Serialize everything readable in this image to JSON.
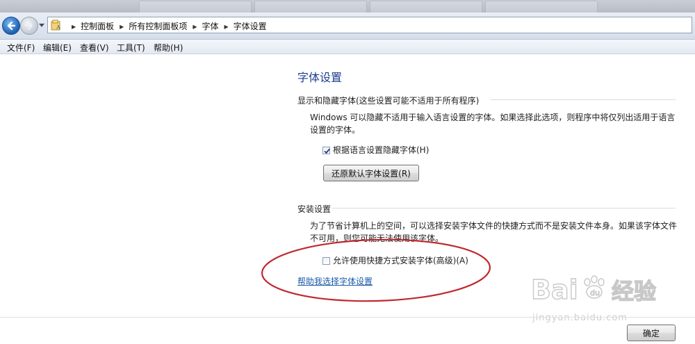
{
  "navigation": {
    "breadcrumbs": [
      "控制面板",
      "所有控制面板项",
      "字体",
      "字体设置"
    ]
  },
  "menu": {
    "items": [
      "文件(F)",
      "编辑(E)",
      "查看(V)",
      "工具(T)",
      "帮助(H)"
    ]
  },
  "page": {
    "title": "字体设置",
    "display_group": {
      "header": "显示和隐藏字体(这些设置可能不适用于所有程序)",
      "description": "Windows 可以隐藏不适用于输入语言设置的字体。如果选择此选项，则程序中将仅列出适用于语言设置的字体。",
      "checkbox_label": "根据语言设置隐藏字体(H)",
      "checkbox_checked": true,
      "restore_button": "还原默认字体设置(R)"
    },
    "install_group": {
      "header": "安装设置",
      "description": "为了节省计算机上的空间，可以选择安装字体文件的快捷方式而不是安装文件本身。如果该字体文件不可用，则您可能无法使用该字体。",
      "checkbox_label": "允许使用快捷方式安装字体(高级)(A)",
      "checkbox_checked": false
    },
    "help_link": "帮助我选择字体设置",
    "ok_button": "确定"
  },
  "watermark": {
    "brand": "Bai  经验",
    "url": "jingyan.baidu.com"
  },
  "colors": {
    "title": "#1e3d8f",
    "link": "#1a5aa8",
    "annotation": "#c0282d"
  }
}
